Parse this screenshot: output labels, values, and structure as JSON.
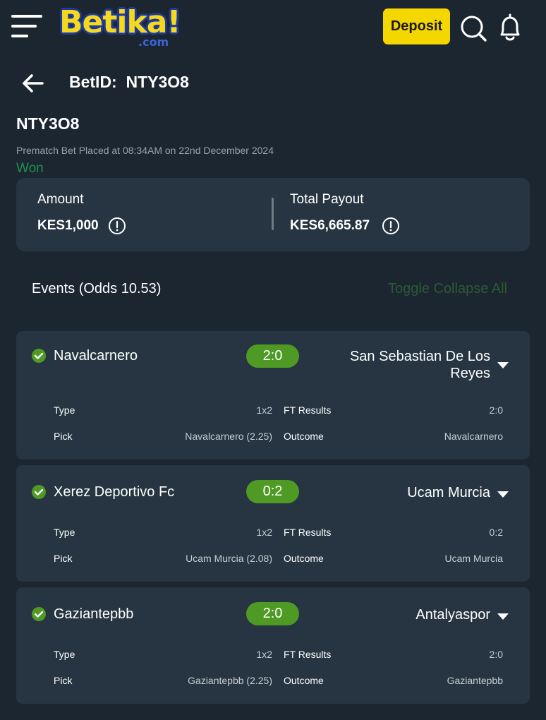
{
  "brand": {
    "logo_main": "Betika!",
    "logo_sub": ".com"
  },
  "topbar": {
    "deposit_label": "Deposit"
  },
  "header": {
    "title": "BetID:  NTY3O8"
  },
  "bet": {
    "code": "NTY3O8",
    "placed": "Prematch Bet Placed at 08:34AM on 22nd December 2024",
    "status": "Won",
    "amount_label": "Amount",
    "amount_value": "KES1,000",
    "payout_label": "Total Payout",
    "payout_value": "KES6,665.87"
  },
  "events_header": {
    "title": "Events (Odds 10.53)",
    "toggle_label": "Toggle Collapse All"
  },
  "labels": {
    "type": "Type",
    "pick": "Pick",
    "ft_results": "FT Results",
    "outcome": "Outcome"
  },
  "events": [
    {
      "home": "Navalcarnero",
      "score": "2:0",
      "away": "San Sebastian De Los Reyes",
      "type": "1x2",
      "pick": "Navalcarnero (2.25)",
      "ft_result": "2:0",
      "outcome": "Navalcarnero"
    },
    {
      "home": "Xerez Deportivo Fc",
      "score": "0:2",
      "away": "Ucam Murcia",
      "type": "1x2",
      "pick": "Ucam Murcia (2.08)",
      "ft_result": "0:2",
      "outcome": "Ucam Murcia"
    },
    {
      "home": "Gaziantepbb",
      "score": "2:0",
      "away": "Antalyaspor",
      "type": "1x2",
      "pick": "Gaziantepbb (2.25)",
      "ft_result": "2:0",
      "outcome": "Gaziantepbb"
    }
  ],
  "colors": {
    "background": "#1b2630",
    "card": "#263541",
    "won": "#1f8f4f",
    "score_pill": "#4f9a25",
    "deposit": "#f5d700",
    "toggle": "#2b5a37"
  }
}
